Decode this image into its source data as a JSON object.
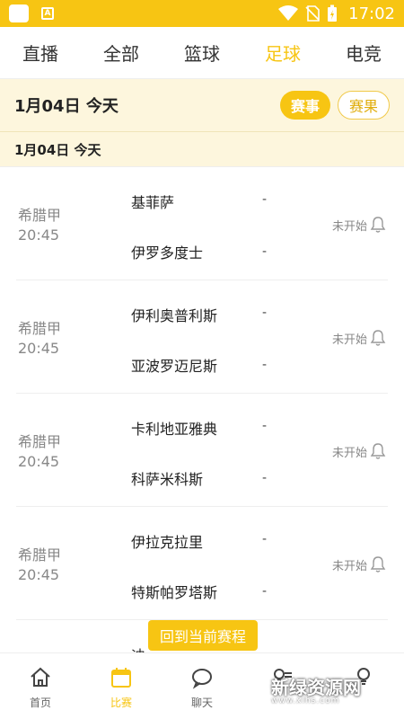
{
  "status_bar": {
    "time": "17:02",
    "icons": [
      "app-square-icon",
      "a-badge-icon",
      "wifi-icon",
      "no-sim-icon",
      "battery-charging-icon"
    ]
  },
  "tabs": [
    {
      "label": "直播"
    },
    {
      "label": "全部"
    },
    {
      "label": "篮球"
    },
    {
      "label": "足球",
      "active": true
    },
    {
      "label": "电竞"
    }
  ],
  "date_header": {
    "date": "1月04日  今天",
    "btn_events": "赛事",
    "btn_results": "赛果"
  },
  "sub_header": {
    "date": "1月04日  今天"
  },
  "matches": [
    {
      "league": "希腊甲",
      "time": "20:45",
      "home": "基菲萨",
      "away": "伊罗多度士",
      "home_score": "-",
      "away_score": "-",
      "status": "未开始"
    },
    {
      "league": "希腊甲",
      "time": "20:45",
      "home": "伊利奥普利斯",
      "away": "亚波罗迈尼斯",
      "home_score": "-",
      "away_score": "-",
      "status": "未开始"
    },
    {
      "league": "希腊甲",
      "time": "20:45",
      "home": "卡利地亚雅典",
      "away": "科萨米科斯",
      "home_score": "-",
      "away_score": "-",
      "status": "未开始"
    },
    {
      "league": "希腊甲",
      "time": "20:45",
      "home": "伊拉克拉里",
      "away": "特斯帕罗塔斯",
      "home_score": "-",
      "away_score": "-",
      "status": "未开始"
    },
    {
      "league": "",
      "time": "",
      "home": "迪",
      "away": "",
      "home_score": "",
      "away_score": "",
      "status": ""
    }
  ],
  "back_button": "回到当前赛程",
  "bottom_nav": [
    {
      "label": "首页",
      "icon": "home-icon"
    },
    {
      "label": "比赛",
      "icon": "calendar-icon",
      "active": true
    },
    {
      "label": "聊天",
      "icon": "chat-bubble-icon"
    },
    {
      "label": "",
      "icon": "list-bulb-icon"
    },
    {
      "label": "",
      "icon": "bulb-icon"
    }
  ],
  "watermark": {
    "main": "新绿资源网",
    "sub": "www.xlhs.com"
  },
  "colors": {
    "accent": "#f7c513",
    "header_bg": "#fdf6dd",
    "muted_text": "#888888"
  }
}
